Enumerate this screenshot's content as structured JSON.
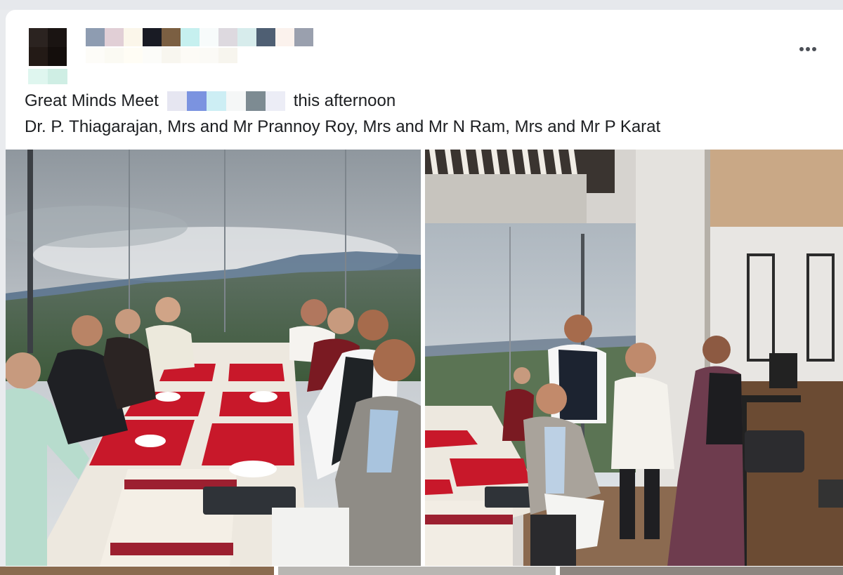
{
  "post": {
    "caption_prefix": "Great Minds Meet",
    "caption_suffix": "this afternoon",
    "caption_line2": "Dr. P. Thiagarajan, Mrs and Mr Prannoy Roy, Mrs and Mr N Ram, Mrs and Mr P Karat"
  },
  "icons": {
    "more": "more-options-icon"
  },
  "photos": [
    {
      "subject": "group-lunch-table"
    },
    {
      "subject": "group-standing-portrait"
    }
  ]
}
